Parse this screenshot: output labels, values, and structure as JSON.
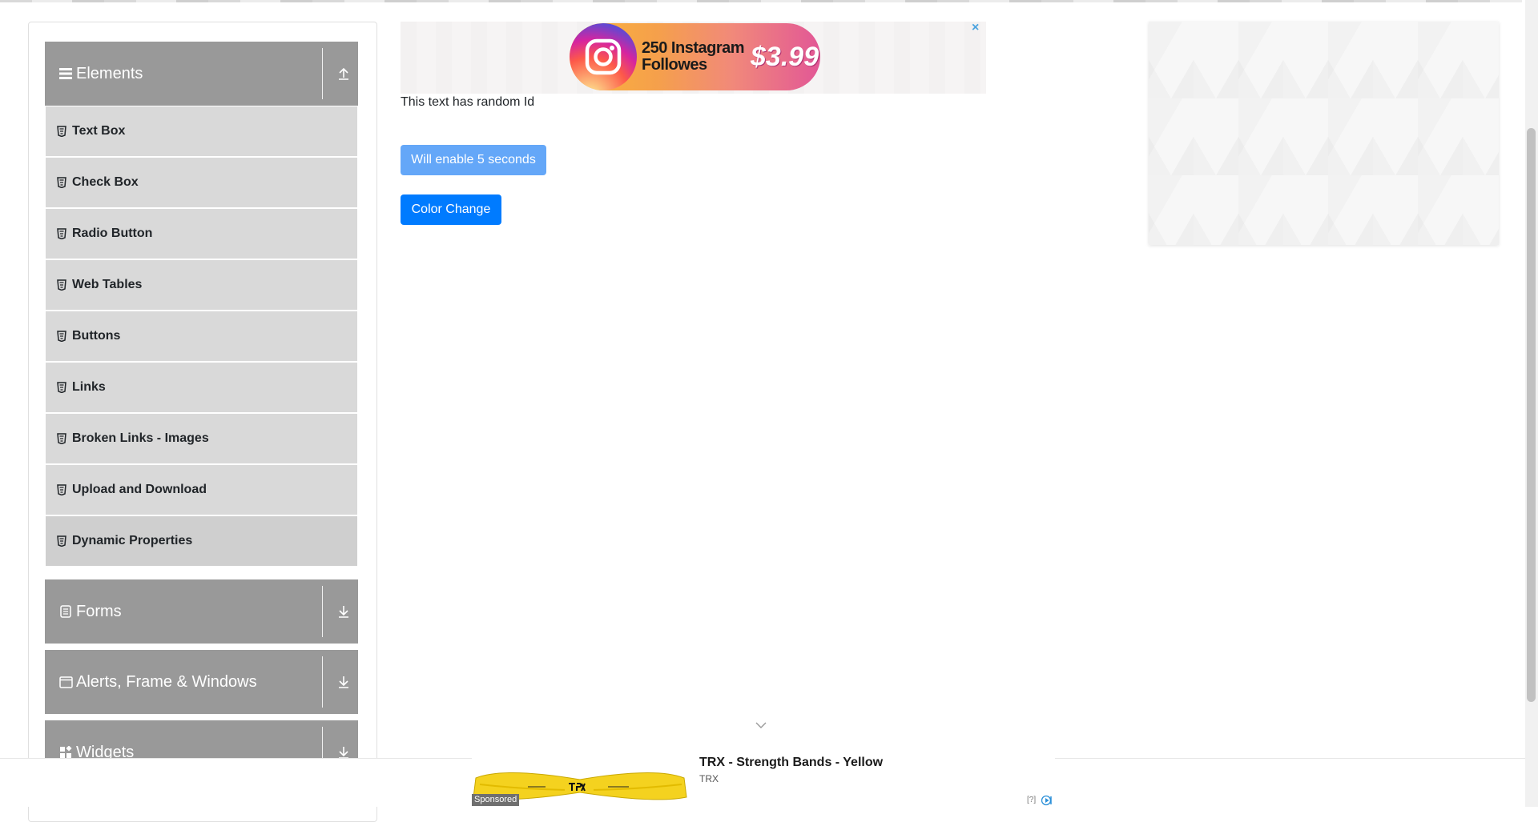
{
  "sidebar": {
    "groups": [
      {
        "label": "Elements",
        "icon": "hamburger-icon",
        "arrow": "collapse-up-icon"
      },
      {
        "label": "Forms",
        "icon": "document-icon",
        "arrow": "expand-down-icon"
      },
      {
        "label": "Alerts, Frame & Windows",
        "icon": "window-icon",
        "arrow": "expand-down-icon"
      },
      {
        "label": "Widgets",
        "icon": "widgets-icon",
        "arrow": "expand-down-icon"
      }
    ],
    "items": [
      {
        "label": "Text Box"
      },
      {
        "label": "Check Box"
      },
      {
        "label": "Radio Button"
      },
      {
        "label": "Web Tables"
      },
      {
        "label": "Buttons"
      },
      {
        "label": "Links"
      },
      {
        "label": "Broken Links - Images"
      },
      {
        "label": "Upload and Download"
      },
      {
        "label": "Dynamic Properties"
      }
    ],
    "active_item": "Dynamic Properties"
  },
  "ad_top": {
    "line1": "250 Instagram",
    "line2": "Followes",
    "price": "$3.99",
    "close": "×"
  },
  "main": {
    "random_text": "This text has random Id",
    "enable_button": "Will enable 5 seconds",
    "color_button": "Color Change"
  },
  "sponsored": {
    "tag": "Sponsored",
    "title": "TRX - Strength Bands - Yellow",
    "brand": "TRX",
    "help": "[?]"
  },
  "colors": {
    "sidebar_header": "#999999",
    "sidebar_item": "#d9d9d9",
    "primary": "#007bff",
    "disabled_primary": "#64a7f8"
  }
}
